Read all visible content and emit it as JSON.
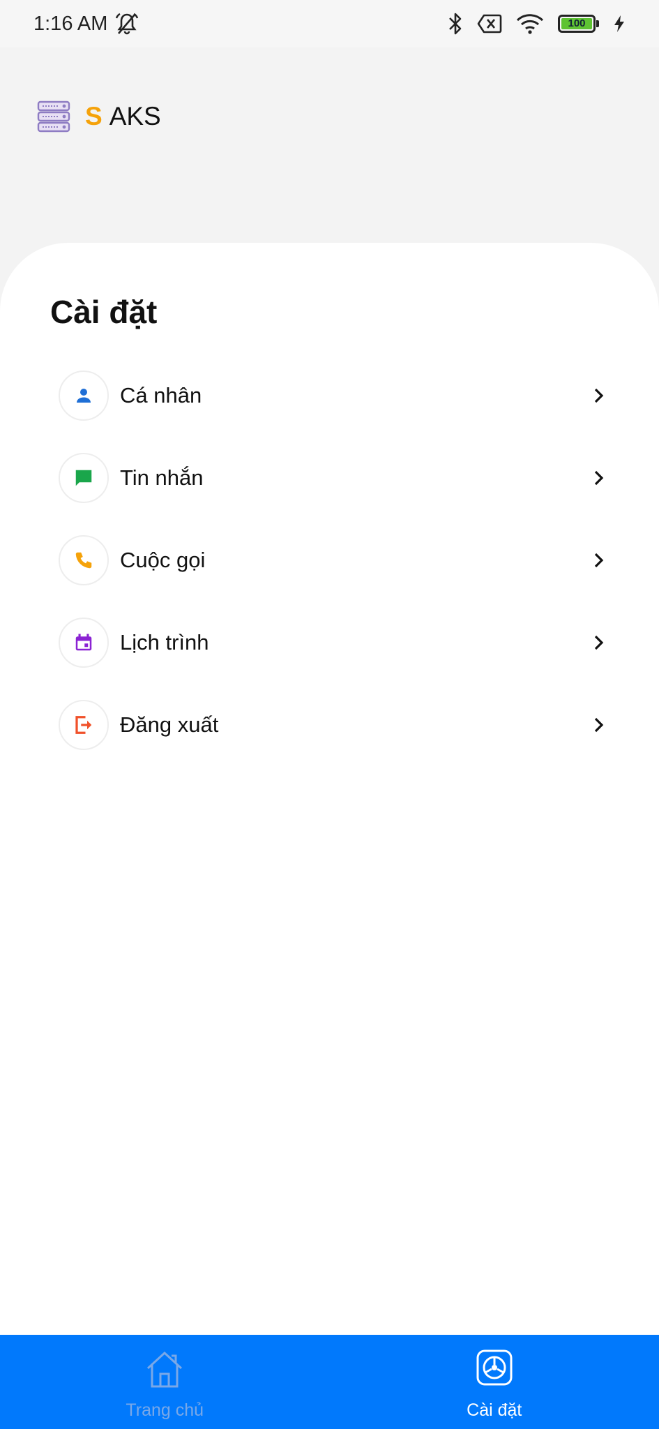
{
  "status_bar": {
    "time": "1:16 AM",
    "battery": "100",
    "icons": [
      "bell-off-icon",
      "bluetooth-icon",
      "no-sim-icon",
      "wifi-icon",
      "battery-icon",
      "charging-icon"
    ]
  },
  "app": {
    "logo_letter": "S",
    "logo_name": "AKS",
    "accent_color": "#f5a20a"
  },
  "settings": {
    "title": "Cài đặt",
    "items": [
      {
        "label": "Cá nhân",
        "icon": "person-icon",
        "color": "#1f6fd6"
      },
      {
        "label": "Tin nhắn",
        "icon": "message-icon",
        "color": "#1aa64b"
      },
      {
        "label": "Cuộc gọi",
        "icon": "phone-icon",
        "color": "#f5a20a"
      },
      {
        "label": "Lịch trình",
        "icon": "calendar-icon",
        "color": "#8b23d3"
      },
      {
        "label": "Đăng xuất",
        "icon": "logout-icon",
        "color": "#f0512a"
      }
    ]
  },
  "bottom_nav": {
    "background": "#0179fc",
    "tabs": [
      {
        "label": "Trang chủ",
        "icon": "home-icon",
        "active": false
      },
      {
        "label": "Cài đặt",
        "icon": "settings-icon",
        "active": true
      }
    ]
  }
}
